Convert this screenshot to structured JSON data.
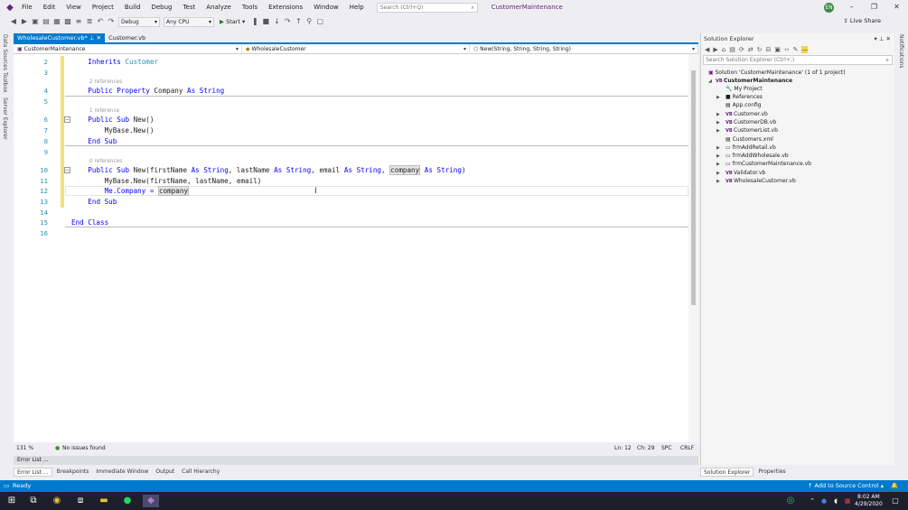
{
  "menu": [
    "File",
    "Edit",
    "View",
    "Project",
    "Build",
    "Debug",
    "Test",
    "Analyze",
    "Tools",
    "Extensions",
    "Window",
    "Help"
  ],
  "search_placeholder": "Search (Ctrl+Q)",
  "project_title": "CustomerMaintenance",
  "avatar": "EN",
  "toolbar": {
    "config": "Debug",
    "platform": "Any CPU",
    "start": "Start"
  },
  "live_share": "Live Share",
  "left_tabs": [
    "Data Sources",
    "Toolbox",
    "Server Explorer"
  ],
  "right_tab": "Notifications",
  "tabs": [
    {
      "label": "WholesaleCustomer.vb*"
    },
    {
      "label": "Customer.vb"
    }
  ],
  "nav": {
    "project": "CustomerMaintenance",
    "class": "WholesaleCustomer",
    "member": "New(String, String, String, String)"
  },
  "lines": [
    "2",
    "3",
    "4",
    "5",
    "6",
    "7",
    "8",
    "9",
    "10",
    "11",
    "12",
    "13",
    "14",
    "15",
    "16"
  ],
  "refs": [
    "2 references",
    "1 reference",
    "0 references"
  ],
  "code": {
    "l2a": "Inherits",
    "l2b": "Customer",
    "l4a": "Public Property",
    "l4b": "Company",
    "l4c": "As",
    "l4d": "String",
    "l6a": "Public Sub",
    "l6b": "New()",
    "l7a": "MyBase.New()",
    "l8a": "End Sub",
    "l10a": "Public Sub",
    "l10b": "New(firstName",
    "l10c": "As",
    "l10d": "String",
    "l10e": ", lastName",
    "l10f": "As",
    "l10g": "String",
    "l10h": ", email",
    "l10i": "As",
    "l10j": "String",
    "l10k": ",",
    "l10l": "company",
    "l10m": "As",
    "l10n": "String",
    "l11a": "MyBase.New(firstName, lastName, email)",
    "l12a": "Me.Company = ",
    "l12b": "company",
    "l13a": "End Sub",
    "l15a": "End Class"
  },
  "editor_status": {
    "zoom": "131 %",
    "issues": "No issues found",
    "ln": "Ln: 12",
    "ch": "Ch: 29",
    "spc": "SPC",
    "crlf": "CRLF"
  },
  "error_panel": "Error List ...",
  "bottom_tabs": [
    "Error List ...",
    "Breakpoints",
    "Immediate Window",
    "Output",
    "Call Hierarchy"
  ],
  "se": {
    "title": "Solution Explorer",
    "search": "Search Solution Explorer (Ctrl+;)",
    "solution": "Solution 'CustomerMaintenance' (1 of 1 project)",
    "project": "CustomerMaintenance",
    "items": [
      "My Project",
      "References",
      "App.config",
      "Customer.vb",
      "CustomerDB.vb",
      "CustomerList.vb",
      "Customers.xml",
      "frmAddRetail.vb",
      "frmAddWholesale.vb",
      "frmCustomerMaintenance.vb",
      "Validator.vb",
      "WholesaleCustomer.vb"
    ],
    "tabs": [
      "Solution Explorer",
      "Properties"
    ]
  },
  "status": {
    "ready": "Ready",
    "source_control": "Add to Source Control"
  },
  "clock": {
    "time": "8:02 AM",
    "date": "4/29/2020"
  }
}
